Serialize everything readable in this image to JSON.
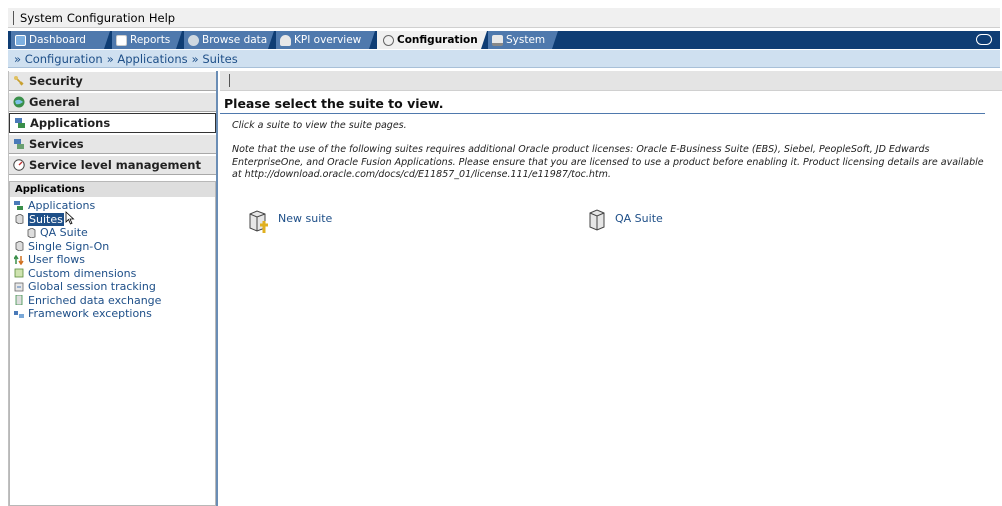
{
  "menubar": {
    "items": [
      "System",
      "Configuration",
      "Help"
    ]
  },
  "tabs": [
    {
      "label": "Dashboard",
      "icon": "dashboard-icon"
    },
    {
      "label": "Reports",
      "icon": "reports-icon"
    },
    {
      "label": "Browse data",
      "icon": "browse-data-icon"
    },
    {
      "label": "KPI overview",
      "icon": "kpi-overview-icon"
    },
    {
      "label": "Configuration",
      "icon": "configuration-icon",
      "active": true
    },
    {
      "label": "System",
      "icon": "system-icon"
    }
  ],
  "breadcrumb": [
    "» Configuration",
    "» Applications",
    "» Suites"
  ],
  "sidebar": {
    "headers": [
      {
        "label": "Security",
        "icon": "key-icon"
      },
      {
        "label": "General",
        "icon": "globe-icon"
      },
      {
        "label": "Applications",
        "icon": "applications-icon"
      },
      {
        "label": "Services",
        "icon": "services-icon"
      },
      {
        "label": "Service level management",
        "icon": "gauge-icon"
      }
    ],
    "tree_title": "Applications",
    "tree": [
      {
        "label": "Applications",
        "icon": "applications-icon"
      },
      {
        "label": "Suites",
        "icon": "suite-icon"
      },
      {
        "label": "QA Suite",
        "icon": "suite-icon"
      },
      {
        "label": "Single Sign-On",
        "icon": "suite-icon"
      },
      {
        "label": "User flows",
        "icon": "user-flows-icon"
      },
      {
        "label": "Custom dimensions",
        "icon": "custom-dimensions-icon"
      },
      {
        "label": "Global session tracking",
        "icon": "session-tracking-icon"
      },
      {
        "label": "Enriched data exchange",
        "icon": "data-exchange-icon"
      },
      {
        "label": "Framework exceptions",
        "icon": "framework-exceptions-icon"
      }
    ]
  },
  "main": {
    "title": "Please select the suite to view.",
    "intro": "Click a suite to view the suite pages.",
    "note": "Note that the use of the following suites requires additional Oracle product licenses: Oracle E-Business Suite (EBS), Siebel, PeopleSoft, JD Edwards EnterpriseOne, and Oracle Fusion Applications. Please ensure that you are licensed to use a product before enabling it. Product licensing details are available at http://download.oracle.com/docs/cd/E11857_01/license.111/e11987/toc.htm.",
    "suites": [
      {
        "label": "New suite",
        "icon": "new-suite-icon"
      },
      {
        "label": "QA Suite",
        "icon": "suite-icon"
      }
    ]
  }
}
